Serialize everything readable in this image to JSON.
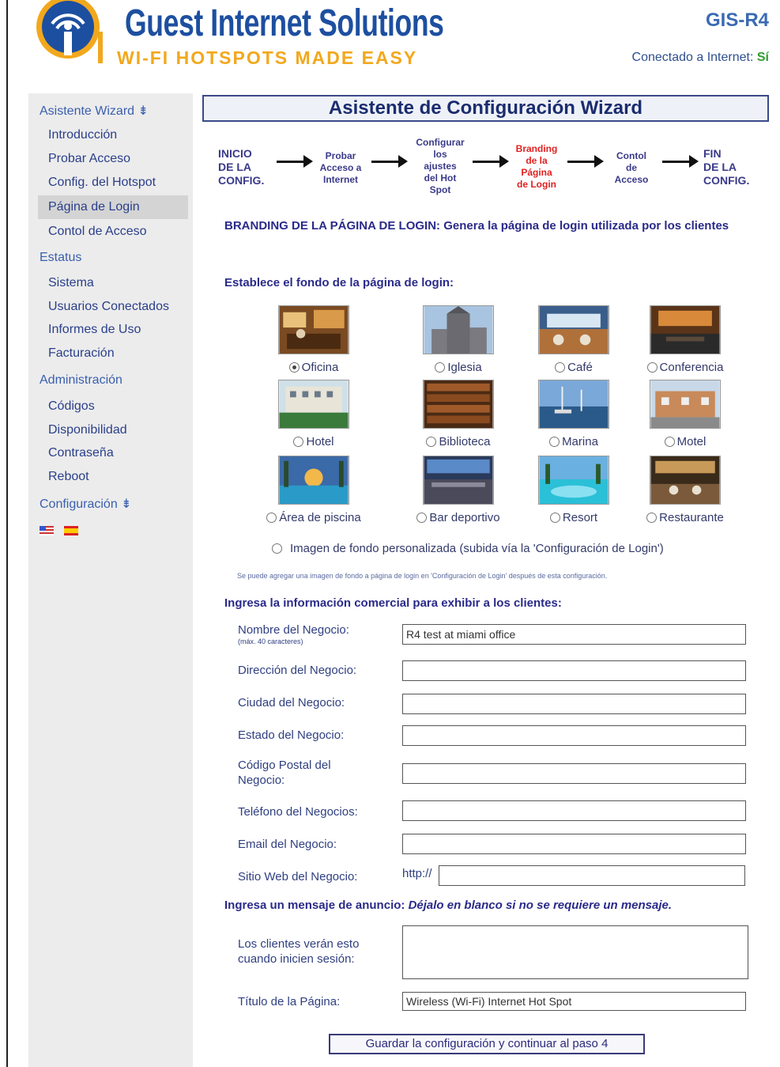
{
  "header": {
    "brand": "Guest Internet Solutions",
    "tagline": "WI-FI HOTSPOTS MADE EASY",
    "model": "GIS-R4",
    "connection_label": "Conectado a Internet:",
    "connection_status": "Sí"
  },
  "sidebar": {
    "sections": [
      {
        "label": "Asistente Wizard ⇟",
        "items": [
          "Introducción",
          "Probar Acceso",
          "Config. del Hotspot",
          "Página de Login",
          "Contol de Acceso"
        ]
      },
      {
        "label": "Estatus",
        "items": [
          "Sistema",
          "Usuarios Conectados",
          "Informes de Uso",
          "Facturación"
        ]
      },
      {
        "label": "Administración",
        "items": [
          "Códigos",
          "Disponibilidad",
          "Contraseña",
          "Reboot"
        ]
      },
      {
        "label": "Configuración ⇟",
        "items": []
      }
    ],
    "active_item": "Página de Login",
    "languages": [
      "en",
      "es"
    ]
  },
  "main": {
    "title": "Asistente de Configuración Wizard",
    "steps": [
      "INICIO\nDE LA\nCONFIG.",
      "Probar\nAcceso a\nInternet",
      "Configurar\nlos\najustes\ndel Hot\nSpot",
      "Branding\nde la\nPágina\nde Login",
      "Contol\nde\nAcceso",
      "FIN\nDE LA\nCONFIG."
    ],
    "active_step": 3,
    "intro": "BRANDING DE LA PÁGINA DE LOGIN: Genera la página de login utilizada por los clientes",
    "background_label": "Establece el fondo de la página de login:",
    "backgrounds": [
      "Oficina",
      "Iglesia",
      "Café",
      "Conferencia",
      "Hotel",
      "Biblioteca",
      "Marina",
      "Motel",
      "Área de piscina",
      "Bar deportivo",
      "Resort",
      "Restaurante"
    ],
    "selected_background": "Oficina",
    "custom_background": "Imagen de fondo personalizada (subida vía la 'Configuración de Login')",
    "custom_note": "Se puede agregar una imagen de fondo a página de login en 'Configuración de Login' después de esta configuración.",
    "business_label": "Ingresa la información comercial para exhibir a los clientes:",
    "fields": [
      {
        "label": "Nombre del Negocio:",
        "hint": "(máx. 40 caracteres)",
        "value": "R4 test at miami office"
      },
      {
        "label": "Dirección del Negocio:",
        "value": ""
      },
      {
        "label": "Ciudad del Negocio:",
        "value": ""
      },
      {
        "label": "Estado del Negocio:",
        "value": ""
      },
      {
        "label": "Código Postal del Negocio:",
        "value": ""
      },
      {
        "label": "Teléfono del Negocios:",
        "value": ""
      },
      {
        "label": "Email del Negocio:",
        "value": ""
      },
      {
        "label": "Sitio Web del Negocio:",
        "prefix": "http://",
        "value": ""
      }
    ],
    "message_label": "Ingresa un mensaje de anuncio:",
    "message_hint": "Déjalo en blanco si no se requiere un mensaje.",
    "message_field_label": "Los clientes verán esto cuando inicien sesión:",
    "message_value": "",
    "page_title_label": "Título de la Página:",
    "page_title_value": "Wireless (Wi-Fi) Internet Hot Spot",
    "save_button": "Guardar la configuración y continuar al paso 4"
  },
  "colors": {
    "brand_blue": "#1d4fa0",
    "tagline_orange": "#f2a81d",
    "active_step": "#e02020",
    "sidebar_bg": "#ececec"
  }
}
